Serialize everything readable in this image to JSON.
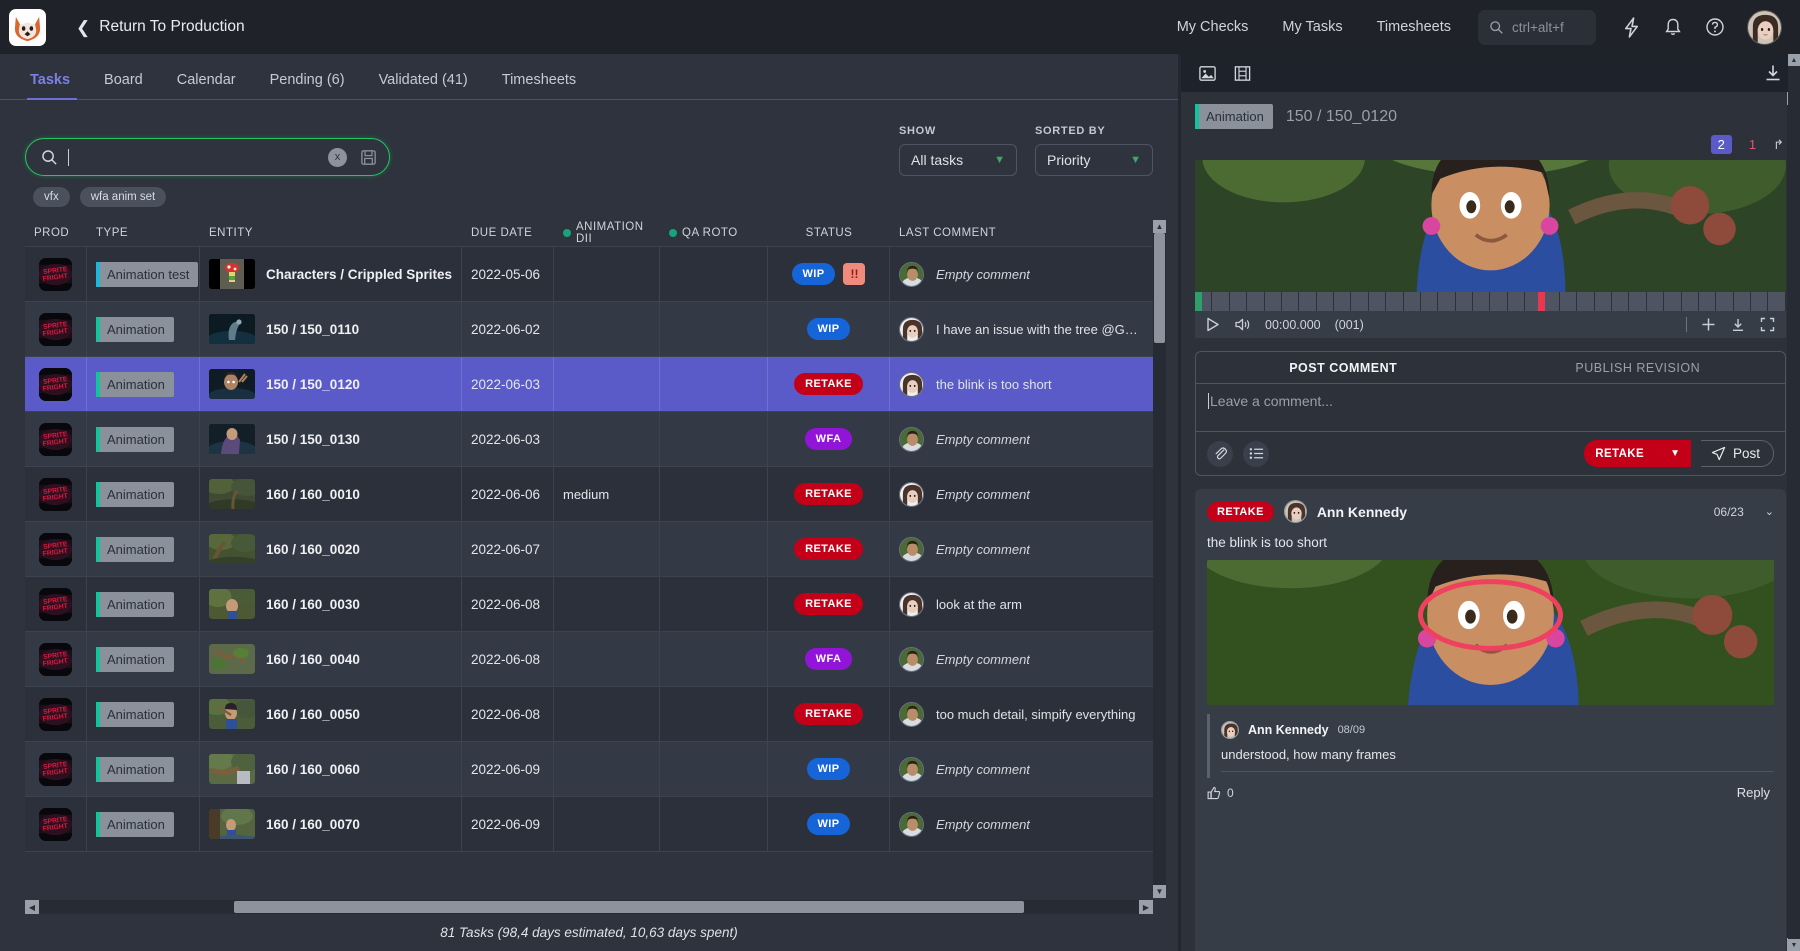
{
  "header": {
    "back_label": "Return To Production",
    "nav": [
      "My Checks",
      "My Tasks",
      "Timesheets"
    ],
    "search_placeholder": "ctrl+alt+f",
    "icons": [
      "lightning-icon",
      "bell-icon",
      "help-icon",
      "avatar"
    ]
  },
  "tabs": [
    {
      "label": "Tasks",
      "active": true
    },
    {
      "label": "Board",
      "active": false
    },
    {
      "label": "Calendar",
      "active": false
    },
    {
      "label": "Pending (6)",
      "active": false
    },
    {
      "label": "Validated (41)",
      "active": false
    },
    {
      "label": "Timesheets",
      "active": false
    }
  ],
  "search": {
    "value": "",
    "placeholder": ""
  },
  "chips": [
    "vfx",
    "wfa anim set"
  ],
  "filters": {
    "show_label": "SHOW",
    "show_value": "All tasks",
    "sorted_label": "SORTED BY",
    "sorted_value": "Priority"
  },
  "table": {
    "columns": [
      "PROD",
      "TYPE",
      "ENTITY",
      "DUE DATE",
      "ANIMATION DII",
      "QA ROTO",
      "STATUS",
      "LAST COMMENT"
    ],
    "rows": [
      {
        "type": "Animation test",
        "type_color": "cyan",
        "entity": "Characters / Crippled Sprites",
        "due": "2022-05-06",
        "anim": "",
        "qa": "",
        "status": "WIP",
        "status_class": "st-wip",
        "priority": "!!",
        "comment": "Empty comment",
        "empty": true,
        "selected": false
      },
      {
        "type": "Animation",
        "type_color": "green",
        "entity": "150 / 150_0110",
        "due": "2022-06-02",
        "anim": "",
        "qa": "",
        "status": "WIP",
        "status_class": "st-wip",
        "priority": "",
        "comment": "I have an issue with the tree @Gwenaell",
        "empty": false,
        "selected": false
      },
      {
        "type": "Animation",
        "type_color": "green",
        "entity": "150 / 150_0120",
        "due": "2022-06-03",
        "anim": "",
        "qa": "",
        "status": "RETAKE",
        "status_class": "st-retake",
        "priority": "",
        "comment": "the blink is too short",
        "empty": false,
        "selected": true
      },
      {
        "type": "Animation",
        "type_color": "green",
        "entity": "150 / 150_0130",
        "due": "2022-06-03",
        "anim": "",
        "qa": "",
        "status": "WFA",
        "status_class": "st-wfa",
        "priority": "",
        "comment": "Empty comment",
        "empty": true,
        "selected": false
      },
      {
        "type": "Animation",
        "type_color": "green",
        "entity": "160 / 160_0010",
        "due": "2022-06-06",
        "anim": "medium",
        "qa": "",
        "status": "RETAKE",
        "status_class": "st-retake",
        "priority": "",
        "comment": "Empty comment",
        "empty": true,
        "selected": false
      },
      {
        "type": "Animation",
        "type_color": "green",
        "entity": "160 / 160_0020",
        "due": "2022-06-07",
        "anim": "",
        "qa": "",
        "status": "RETAKE",
        "status_class": "st-retake",
        "priority": "",
        "comment": "Empty comment",
        "empty": true,
        "selected": false
      },
      {
        "type": "Animation",
        "type_color": "green",
        "entity": "160 / 160_0030",
        "due": "2022-06-08",
        "anim": "",
        "qa": "",
        "status": "RETAKE",
        "status_class": "st-retake",
        "priority": "",
        "comment": "look at the arm",
        "empty": false,
        "selected": false
      },
      {
        "type": "Animation",
        "type_color": "green",
        "entity": "160 / 160_0040",
        "due": "2022-06-08",
        "anim": "",
        "qa": "",
        "status": "WFA",
        "status_class": "st-wfa",
        "priority": "",
        "comment": "Empty comment",
        "empty": true,
        "selected": false
      },
      {
        "type": "Animation",
        "type_color": "green",
        "entity": "160 / 160_0050",
        "due": "2022-06-08",
        "anim": "",
        "qa": "",
        "status": "RETAKE",
        "status_class": "st-retake",
        "priority": "",
        "comment": "too much detail, simpify everything",
        "empty": false,
        "selected": false
      },
      {
        "type": "Animation",
        "type_color": "green",
        "entity": "160 / 160_0060",
        "due": "2022-06-09",
        "anim": "",
        "qa": "",
        "status": "WIP",
        "status_class": "st-wip",
        "priority": "",
        "comment": "Empty comment",
        "empty": true,
        "selected": false
      },
      {
        "type": "Animation",
        "type_color": "green",
        "entity": "160 / 160_0070",
        "due": "2022-06-09",
        "anim": "",
        "qa": "",
        "status": "WIP",
        "status_class": "st-wip",
        "priority": "",
        "comment": "Empty comment",
        "empty": true,
        "selected": false
      }
    ]
  },
  "footer": {
    "summary": "81 Tasks (98,4 days estimated, 10,63 days spent)"
  },
  "preview": {
    "task_type": "Animation",
    "task_name": "150 / 150_0120",
    "revisions": [
      {
        "label": "2",
        "active": true
      },
      {
        "label": "1",
        "active": false
      }
    ],
    "player": {
      "time": "00:00.000",
      "frame": "(001)"
    },
    "comment_tabs": [
      {
        "label": "POST COMMENT",
        "active": true
      },
      {
        "label": "PUBLISH REVISION",
        "active": false
      }
    ],
    "comment_placeholder": "Leave a comment...",
    "post_status": "RETAKE",
    "post_label": "Post",
    "thread": {
      "badge": "RETAKE",
      "author": "Ann Kennedy",
      "date": "06/23",
      "text": "the blink is too short",
      "reply": {
        "author": "Ann Kennedy",
        "date": "08/09",
        "text": "understood, how many frames",
        "likes": "0",
        "reply_label": "Reply"
      }
    }
  },
  "colors": {
    "accent": "#5a5bc8",
    "green": "#22c55e",
    "retake": "#c30017",
    "wip": "#1565d8",
    "wfa": "#9214d8"
  }
}
